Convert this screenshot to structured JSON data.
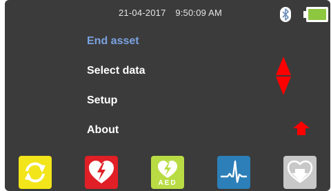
{
  "status": {
    "date": "21-04-2017",
    "time": "9:50:09 AM",
    "battery_level": 1.0,
    "battery_color": "#8dc63f",
    "bluetooth_icon": "bluetooth-icon"
  },
  "menu": {
    "selected_index": 0,
    "items": [
      {
        "label": "End asset"
      },
      {
        "label": "Select data"
      },
      {
        "label": "Setup"
      },
      {
        "label": "About"
      }
    ]
  },
  "nav": {
    "scroll_icon": "up-down-arrows-icon",
    "home_icon": "up-arrow-icon",
    "arrow_color": "#ff0000"
  },
  "function_buttons": [
    {
      "icon": "refresh-icon",
      "color": "#f2e51a"
    },
    {
      "icon": "defib-heart-icon",
      "color": "#e01f26"
    },
    {
      "icon": "aed-heart-icon",
      "color": "#b9dc45",
      "label": "AED"
    },
    {
      "icon": "ecg-waveform-icon",
      "color": "#2c7fb8"
    },
    {
      "icon": "download-heart-icon",
      "color": "#c8c8c8"
    }
  ],
  "colors": {
    "background": "#3b3b3b",
    "selected_text": "#7aa2e0",
    "text": "#ffffff"
  }
}
